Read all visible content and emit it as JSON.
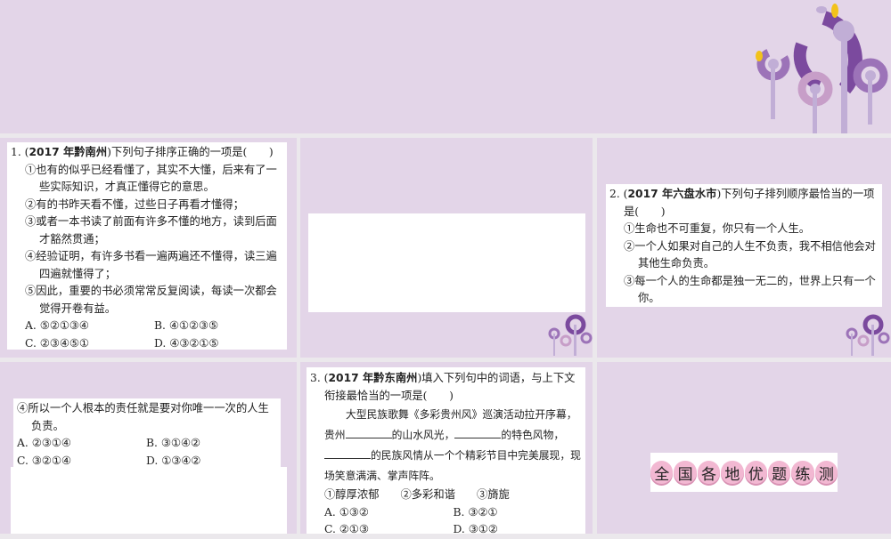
{
  "q1": {
    "num": "1. (",
    "year": "2017 年黔南州",
    "stem": ")下列句子排序正确的一项是(　　)",
    "items": [
      "①也有的似乎已经看懂了，其实不大懂，后来有了一些实际知识，才真正懂得它的意思。",
      "②有的书昨天看不懂，过些日子再看才懂得；",
      "③或者一本书读了前面有许多不懂的地方，读到后面才豁然贯通；",
      "④经验证明，有许多书看一遍两遍还不懂得，读三遍四遍就懂得了；",
      "⑤因此，重要的书必须常常反复阅读，每读一次都会觉得开卷有益。"
    ],
    "options": [
      "A. ⑤②①③④",
      "B. ④①②③⑤",
      "C. ②③④⑤①",
      "D. ④③②①⑤"
    ]
  },
  "q2": {
    "num": "2. (",
    "year": "2017 年六盘水市",
    "stem": ")下列句子排列顺序最恰当的一项是(　　)",
    "items": [
      "①生命也不可重复，你只有一个人生。",
      "②一个人如果对自己的人生不负责，我不相信他会对其他生命负责。",
      "③每一个人的生命都是独一无二的，世界上只有一个你。"
    ],
    "item4": "④所以一个人根本的责任就是要对你唯一一次的人生负责。",
    "options": [
      "A. ②③①④",
      "B. ③①④②",
      "C. ③②①④",
      "D. ①③④②"
    ]
  },
  "q3": {
    "num": "3. (",
    "year": "2017 年黔东南州",
    "stem": ")填入下列句中的词语，与上下文衔接最恰当的一项是(　　)",
    "p1": "大型民族歌舞《多彩贵州风》巡演活动拉开序幕，贵州",
    "p2": "的山水风光，",
    "p3": "的特色风物，",
    "p4": "的民族风情从一个个精彩节目中完美展现，现场笑意满满、掌声阵阵。",
    "words": [
      "①醇厚浓郁",
      "②多彩和谐",
      "③旖旎"
    ],
    "options": [
      "A. ①③②",
      "B. ③②①",
      "C. ②①③",
      "D. ③①②"
    ]
  },
  "badge": [
    "全",
    "国",
    "各",
    "地",
    "优",
    "题",
    "练",
    "测"
  ],
  "colors": {
    "bg": "#e3d5e8",
    "purple": "#7b4a9e",
    "light": "#c1aed6",
    "yellow": "#f2c21b",
    "pink": "#f2b8d2"
  }
}
